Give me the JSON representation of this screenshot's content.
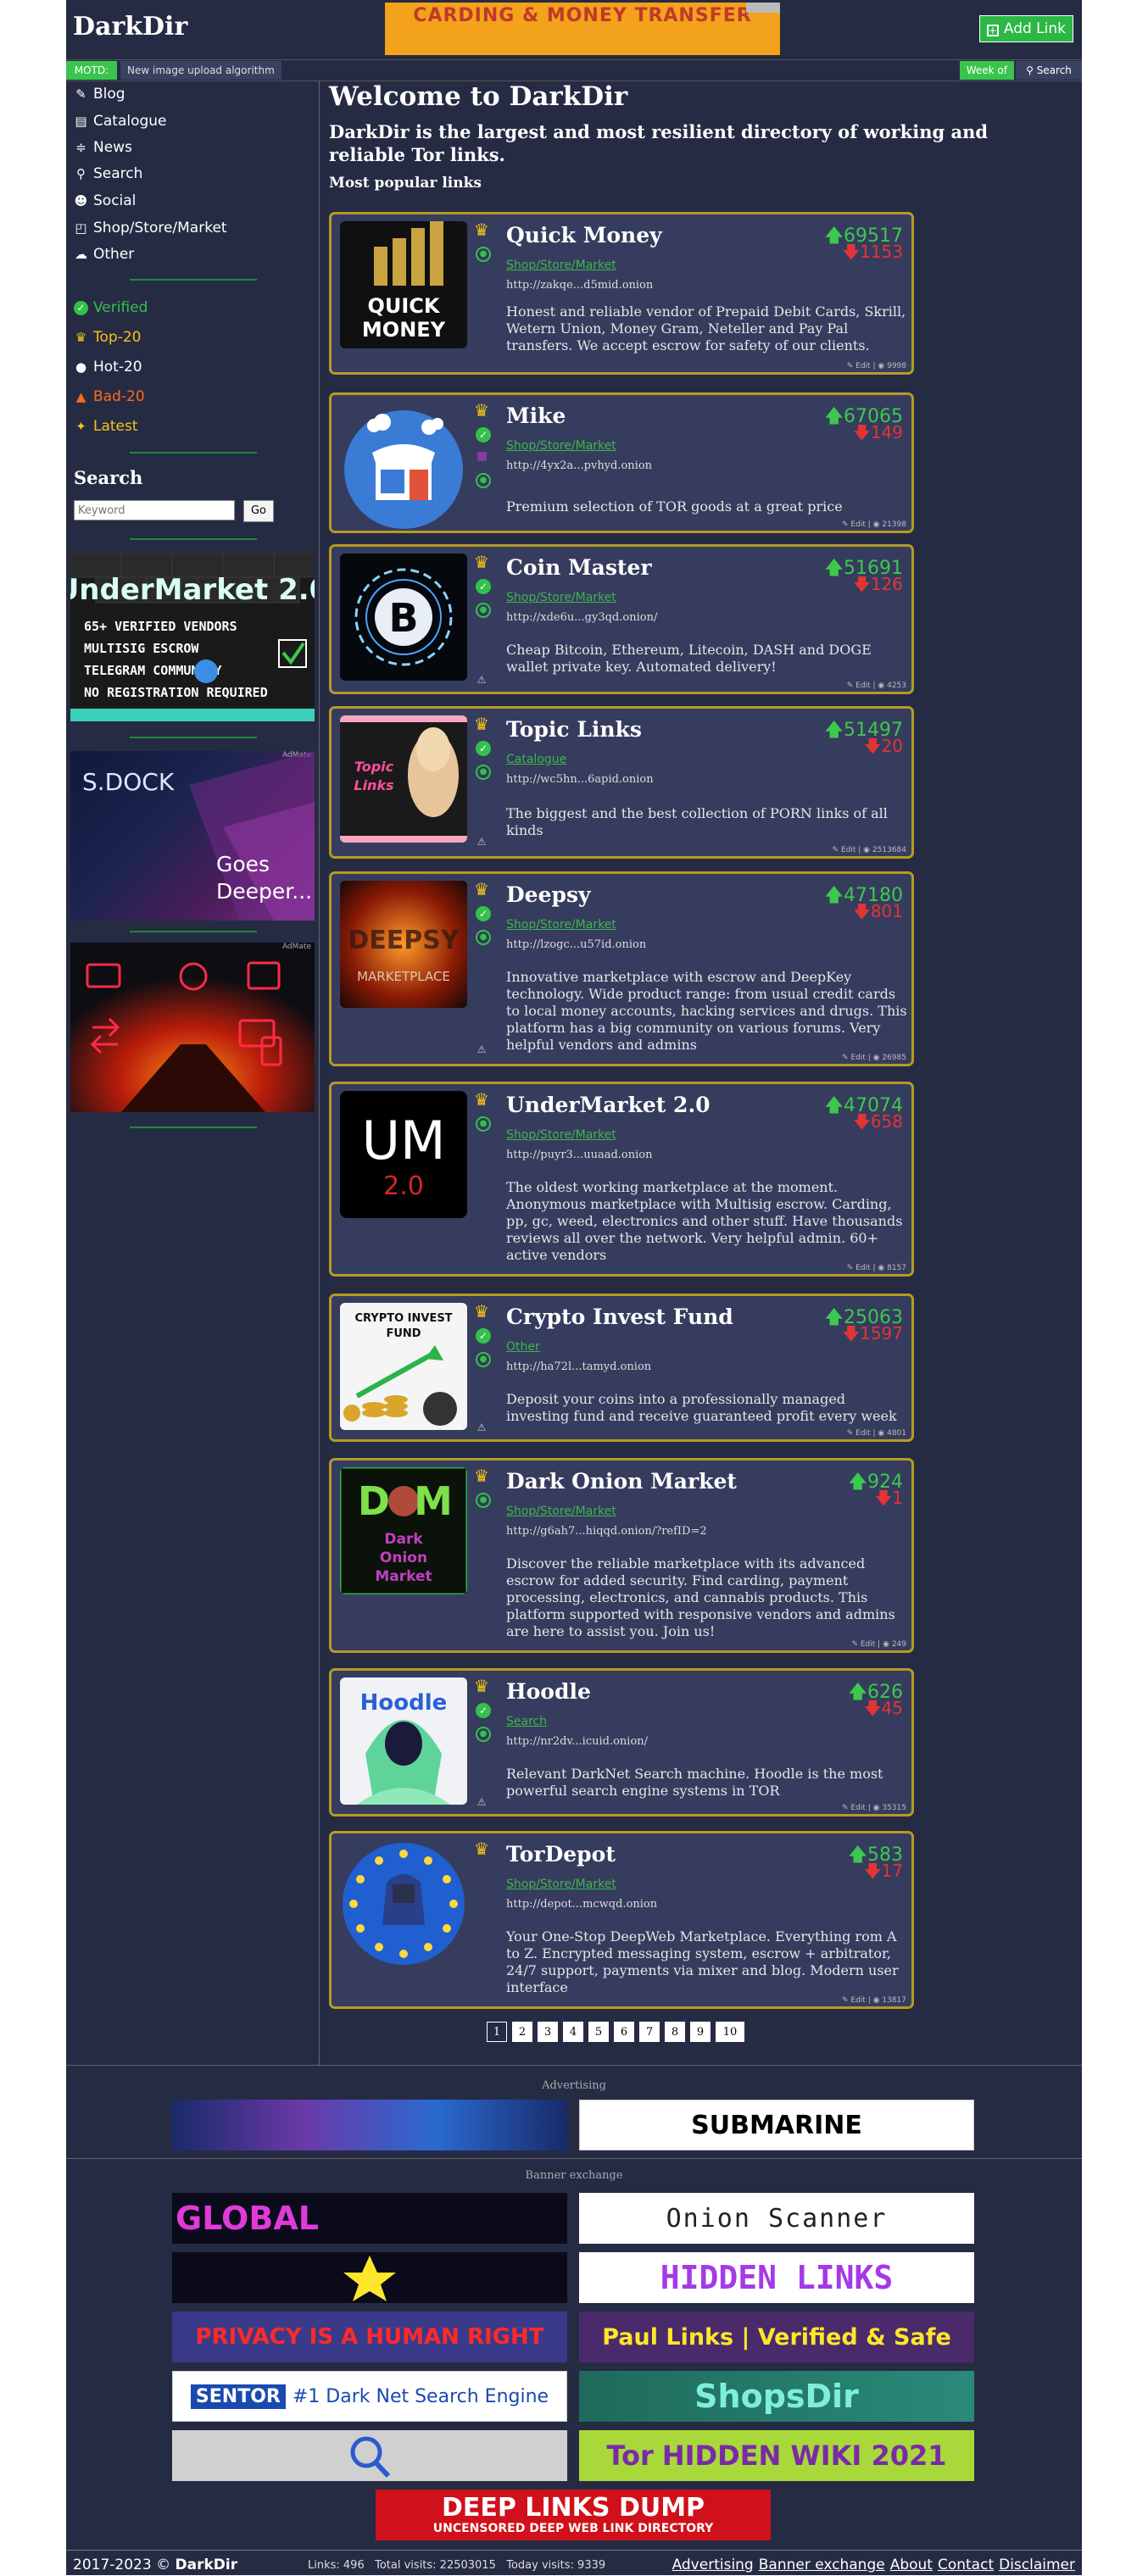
{
  "header": {
    "logo": "DarkDir",
    "top_banner": "CARDING & MONEY TRANSFER",
    "add_link": "Add Link"
  },
  "motd": {
    "label": "MOTD:",
    "text": "New image upload algorithm",
    "week": "Week of",
    "search": "Search"
  },
  "sidebar": {
    "nav": [
      {
        "label": "Blog",
        "icon": "blog-icon"
      },
      {
        "label": "Catalogue",
        "icon": "catalogue-icon"
      },
      {
        "label": "News",
        "icon": "rss-icon"
      },
      {
        "label": "Search",
        "icon": "search-icon"
      },
      {
        "label": "Social",
        "icon": "users-icon"
      },
      {
        "label": "Shop/Store/Market",
        "icon": "shop-icon"
      },
      {
        "label": "Other",
        "icon": "cloud-icon"
      }
    ],
    "filters": [
      {
        "label": "Verified",
        "color": "#33c14b"
      },
      {
        "label": "Top-20",
        "color": "#f5c518"
      },
      {
        "label": "Hot-20",
        "color": "#ffffff"
      },
      {
        "label": "Bad-20",
        "color": "#ff6a1a"
      },
      {
        "label": "Latest",
        "color": "#f5c518"
      }
    ],
    "search_title": "Search",
    "search_placeholder": "Keyword",
    "go": "Go",
    "ads": {
      "undermarket_title": "UnderMarket 2.0",
      "undermarket_lines": [
        "65+ VERIFIED VENDORS",
        "MULTISIG ESCROW",
        "TELEGRAM COMMUNITY",
        "NO REGISTRATION REQUIRED"
      ],
      "sdock_title": "S.DOCK",
      "sdock_tagline": "Goes Deeper...",
      "ad_tag": "AdMate"
    }
  },
  "main": {
    "welcome": "Welcome to DarkDir",
    "subtitle": "DarkDir is the largest and most resilient directory of working and reliable Tor links.",
    "popular": "Most popular links",
    "links": [
      {
        "title": "Quick Money",
        "category": "Shop/Store/Market",
        "url": "http://zakqe...d5mid.onion",
        "desc": "Honest and reliable vendor of Prepaid Debit Cards, Skrill, Wetern Union, Money Gram, Neteller and Pay Pal transfers. We accept escrow for safety of our clients.",
        "up": "69517",
        "down": "1153",
        "views": "9998",
        "verified": false,
        "thumb_text": "QUICK MONEY"
      },
      {
        "title": "Mike",
        "category": "Shop/Store/Market",
        "url": "http://4yx2a...pvhyd.onion",
        "desc": "Premium selection of TOR goods at a great price",
        "up": "67065",
        "down": "149",
        "views": "21398",
        "verified": true,
        "thumb_text": ""
      },
      {
        "title": "Coin Master",
        "category": "Shop/Store/Market",
        "url": "http://xde6u...gy3qd.onion/",
        "desc": "Cheap Bitcoin, Ethereum, Litecoin, DASH and DOGE wallet private key. Automated delivery!",
        "up": "51691",
        "down": "126",
        "views": "4253",
        "verified": true,
        "thumb_text": "₿"
      },
      {
        "title": "Topic Links",
        "category": "Catalogue",
        "url": "http://wc5hn...6apid.onion",
        "desc": "The biggest and the best collection of PORN links of all kinds",
        "up": "51497",
        "down": "20",
        "views": "2513684",
        "verified": true,
        "thumb_text": "Topic Links"
      },
      {
        "title": "Deepsy",
        "category": "Shop/Store/Market",
        "url": "http://lzogc...u57id.onion",
        "desc": "Innovative marketplace with escrow and DeepKey technology. Wide product range: from usual credit cards to local money accounts, hacking services and drugs. This platform has a big community on various forums. Very helpful vendors and admins",
        "up": "47180",
        "down": "801",
        "views": "26985",
        "verified": true,
        "thumb_text": "MARKETPLACE"
      },
      {
        "title": "UnderMarket 2.0",
        "category": "Shop/Store/Market",
        "url": "http://puyr3...uuaad.onion",
        "desc": "The oldest working marketplace at the moment. Anonymous marketplace with Multisig escrow. Carding, pp, gc, weed, electronics and other stuff. Have thousands reviews all over the network. Very helpful admin. 60+ active vendors",
        "up": "47074",
        "down": "658",
        "views": "8157",
        "verified": false,
        "thumb_text": "UM"
      },
      {
        "title": "Crypto Invest Fund",
        "category": "Other",
        "url": "http://ha72l...tamyd.onion",
        "desc": "Deposit your coins into a professionally managed investing fund and receive guaranteed profit every week",
        "up": "25063",
        "down": "1597",
        "views": "4801",
        "verified": true,
        "thumb_text": "CRYPTO INVEST FUND"
      },
      {
        "title": "Dark Onion Market",
        "category": "Shop/Store/Market",
        "url": "http://g6ah7...hiqqd.onion/?refID=2",
        "desc": "Discover the reliable marketplace with its advanced escrow for added security. Find carding, payment processing, electronics, and cannabis products. This platform supported with responsive vendors and admins are here to assist you. Join us!",
        "up": "924",
        "down": "1",
        "views": "249",
        "verified": false,
        "thumb_text": "Dark Onion Market"
      },
      {
        "title": "Hoodle",
        "category": "Search",
        "url": "http://nr2dv...icuid.onion/",
        "desc": "Relevant DarkNet Search machine. Hoodle is the most powerful search engine systems in TOR",
        "up": "626",
        "down": "45",
        "views": "35315",
        "verified": true,
        "thumb_text": "Hoodle"
      },
      {
        "title": "TorDepot",
        "category": "Shop/Store/Market",
        "url": "http://depot...mcwqd.onion",
        "desc": "Your One-Stop DeepWeb Marketplace. Everything rom A to Z. Encrypted messaging system, escrow + arbitrator, 24/7 support, payments via mixer and blog. Modern user interface",
        "up": "583",
        "down": "17",
        "views": "13817",
        "verified": false,
        "thumb_text": ""
      }
    ],
    "edit_label": "Edit",
    "pages": [
      "1",
      "2",
      "3",
      "4",
      "5",
      "6",
      "7",
      "8",
      "9",
      "10"
    ]
  },
  "advertising": {
    "label": "Advertising",
    "banners": [
      "",
      "SUBMARINE"
    ]
  },
  "banner_exchange": {
    "label": "Banner exchange",
    "banners": [
      "GLOBAL",
      "Onion Scanner",
      "",
      "HIDDEN LINKS",
      "PRIVACY IS A HUMAN RIGHT",
      "Paul Links | Verified & Safe",
      "#1 Dark Net Search Engine",
      "ShopsDir",
      "",
      "HIDDEN WIKI 2021"
    ],
    "sentor": "SENTOR",
    "tor": "Tor",
    "deep_links_title": "DEEP LINKS DUMP",
    "deep_links_sub": "UNCENSORED DEEP WEB LINK DIRECTORY"
  },
  "footer": {
    "copy": "2017-2023 ©",
    "brand": "DarkDir",
    "stats": "Links: 496   Total visits: 22503015   Today visits: 9339",
    "links": [
      "Advertising",
      "Banner exchange",
      "About",
      "Contact",
      "Disclaimer"
    ]
  }
}
